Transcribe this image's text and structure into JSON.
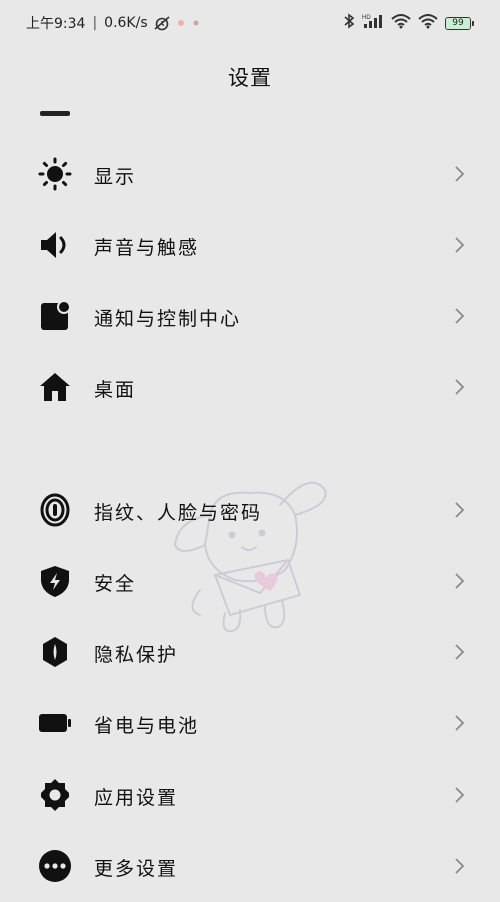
{
  "status_bar": {
    "time": "上午9:34",
    "net_speed": "0.6K/s",
    "battery_level": "99",
    "battery_fill": 0.99,
    "icons": [
      "alarm-off-icon",
      "bluetooth-icon",
      "hd-signal-icon",
      "wifi-icon",
      "wifi-icon",
      "battery-icon"
    ]
  },
  "header": {
    "title": "设置"
  },
  "sections": [
    {
      "items": [
        {
          "label": "显示",
          "icon": "brightness-icon"
        },
        {
          "label": "声音与触感",
          "icon": "speaker-icon"
        },
        {
          "label": "通知与控制中心",
          "icon": "notification-icon"
        },
        {
          "label": "桌面",
          "icon": "home-icon"
        }
      ]
    },
    {
      "items": [
        {
          "label": "指纹、人脸与密码",
          "icon": "fingerprint-icon"
        },
        {
          "label": "安全",
          "icon": "shield-icon"
        },
        {
          "label": "隐私保护",
          "icon": "privacy-icon"
        },
        {
          "label": "省电与电池",
          "icon": "battery-saver-icon"
        },
        {
          "label": "应用设置",
          "icon": "gear-icon"
        },
        {
          "label": "更多设置",
          "icon": "more-icon"
        }
      ]
    }
  ],
  "colors": {
    "background": "#e8e8e8",
    "text": "#111111",
    "chevron": "#8a8a8a",
    "battery_fill": "#c9f0d2"
  }
}
